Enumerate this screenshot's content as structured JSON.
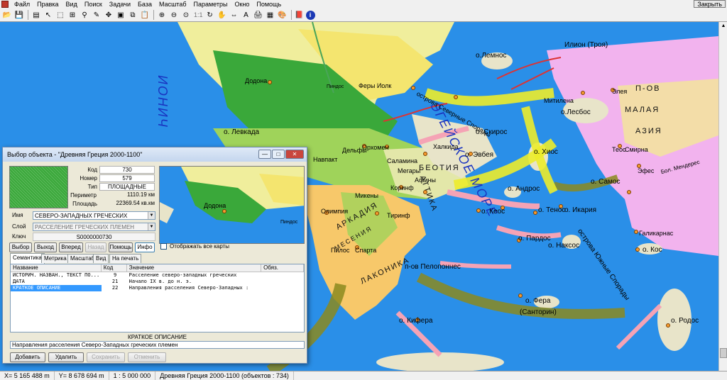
{
  "menu": {
    "items": [
      "Файл",
      "Правка",
      "Вид",
      "Поиск",
      "Задачи",
      "База",
      "Масштаб",
      "Параметры",
      "Окно",
      "Помощь"
    ],
    "close_label": "Закрыть"
  },
  "toolbar": {
    "scale_text": "1:1"
  },
  "map": {
    "seas": {
      "ionian": "ИОНИЧ",
      "aegean": "ЭГЕЙСКОЕ МОРЕ",
      "islands_south": "острова Южные Спорады"
    },
    "regions": {
      "asia_minor_1": "П-ОВ",
      "asia_minor_2": "МАЛАЯ",
      "asia_minor_3": "АЗИЯ",
      "arcadia": "АРКАДИЯ",
      "messenia": "МЕСЕНИЯ",
      "laconica": "ЛАКОНИКА",
      "beotia": "БЕОТИЯ",
      "attica": "АТТИКА"
    },
    "labels": {
      "lemnos": "о.Лемнос",
      "troy": "Илион (Троя)",
      "elaia": "Элея",
      "mitilena": "Митилена",
      "lesbos": "о.Лесбос",
      "smyrna": "Смирна",
      "teos": "Теос",
      "khios": "о. Хиос",
      "efes": "Эфес",
      "samos": "о. Самос",
      "ikaria": "о. Икария",
      "andros": "о. Андрос",
      "tenos": "о. Тенос",
      "keos": "о. Кеос",
      "pardos": "о. Пардос",
      "naxos": "о. Наксос",
      "kos": "о. Кос",
      "galikarnas": "Галикарнас",
      "fera": "о. Фера",
      "santorini": "(Санторин)",
      "rodos": "о. Родос",
      "kifera": "о. Кифера",
      "peloponnes": "п-ов Пелопоннес",
      "sparta": "Спарта",
      "pilos": "Пилос",
      "olimpia": "Олимпия",
      "mikeny": "Микены",
      "tirinf": "Тиринф",
      "korinf": "Коринф",
      "delfy": "Дельфы",
      "orkhomen": "Орхомен",
      "khalkida": "Халкида",
      "euboea": "о. Эвбея",
      "skiros": "о. Скирос",
      "northern_sporades": "острова Северные Спорады",
      "ferai_iolk": "Феры Иолк",
      "dodona": "Додона",
      "levkada": "о. Левкада",
      "pindos": "Пиндос",
      "navpakt": "Навпакт",
      "salamina": "Саламина",
      "megary": "Мегары",
      "afiny": "Афины",
      "maiden_river": "Бол. Мендерес"
    }
  },
  "statusbar": {
    "x": "X= 5 165 488 m",
    "y": "Y= 8 678 694 m",
    "scale": "1 : 5 000 000",
    "map_name": "Древняя Греция  2000-1100  (объектов : 734)"
  },
  "dialog": {
    "title": "Выбор объекта - \"Древняя Греция  2000-1100\"",
    "props": [
      {
        "label": "Код",
        "value": "730"
      },
      {
        "label": "Номер",
        "value": "579"
      },
      {
        "label": "Тип",
        "value": "ПЛОЩАДНЫЕ"
      },
      {
        "label": "Периметр",
        "value": "1110.19  км"
      },
      {
        "label": "Площадь",
        "value": "22369.54  кв.км"
      }
    ],
    "name_label": "Имя",
    "name_value": "СЕВЕРО-ЗАПАДНЫХ ГРЕЧЕСКИХ",
    "layer_label": "Слой",
    "layer_value": "РАССЕЛЕНИЕ ГРЕЧЕСКИХ ПЛЕМЕН",
    "key_label": "Ключ",
    "key_value": "S0000000730",
    "nav_buttons": [
      "Выбор",
      "Выход",
      "Вперед",
      "Назад",
      "Помощь",
      "Инфо"
    ],
    "show_all_maps": "Отображать все карты",
    "tabs": [
      "Семантика",
      "Метрика",
      "Масштаб",
      "Вид",
      "На печать"
    ],
    "table_headers": [
      "Название",
      "Код",
      "Значение",
      "Обяз."
    ],
    "rows": [
      {
        "name": "ИСТОРИЧ. НАЗВАН., ТЕКСТ ПО...",
        "code": "9",
        "value": "Расселение северо-западных греческих",
        "req": ""
      },
      {
        "name": "ДАТА",
        "code": "21",
        "value": "Начало IX в. до н. э.",
        "req": ""
      },
      {
        "name": "КРАТКОЕ ОПИСАНИЕ",
        "code": "22",
        "value": "Направления расселения  Северо-Западных :",
        "req": ""
      }
    ],
    "desc_title": "КРАТКОЕ ОПИСАНИЕ",
    "desc_value": "Направления расселения  Северо-Западных греческих племен",
    "bottom_buttons": [
      "Добавить",
      "Удалить",
      "Сохранить",
      "Отменить"
    ],
    "mini_labels": {
      "dodona": "Додона",
      "pindos": "Пиндос"
    }
  }
}
